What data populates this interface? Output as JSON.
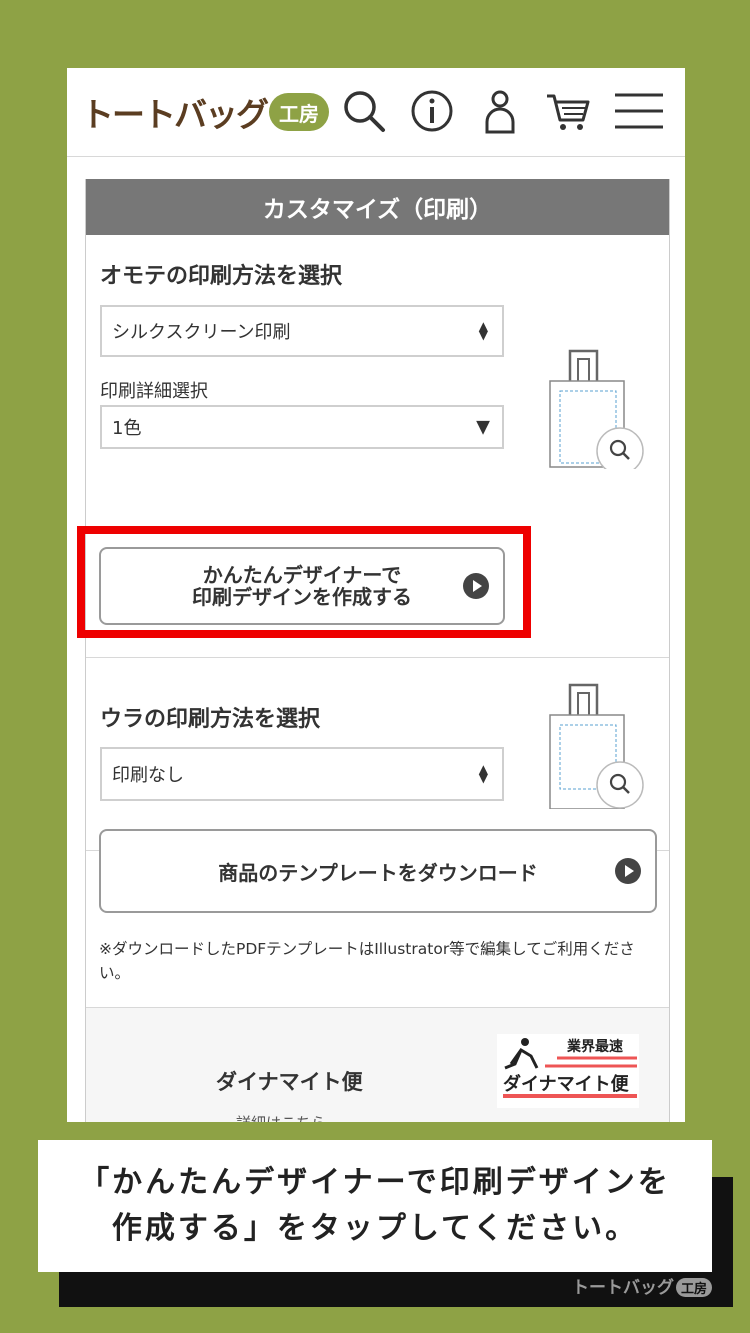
{
  "header": {
    "logo_text": "トートバッグ",
    "logo_badge": "工房"
  },
  "panel": {
    "title": "カスタマイズ（印刷）",
    "front": {
      "title": "オモテの印刷方法を選択",
      "method_value": "シルクスクリーン印刷",
      "detail_label": "印刷詳細選択",
      "detail_value": "1色",
      "designer_button_line1": "かんたんデザイナーで",
      "designer_button_line2": "印刷デザインを作成する"
    },
    "back": {
      "title": "ウラの印刷方法を選択",
      "method_value": "印刷なし"
    },
    "template_button": "商品のテンプレートをダウンロード",
    "template_note": "※ダウンロードしたPDFテンプレートはIllustrator等で編集してご利用ください。",
    "dynamite": {
      "title": "ダイナマイト便",
      "link": "詳細はこちら",
      "banner_line1": "業界最速",
      "banner_line2": "ダイナマイト便"
    }
  },
  "caption": {
    "line1": "「かんたんデザイナーで印刷デザインを",
    "line2": "作成する」をタップしてください。"
  },
  "watermark": {
    "text": "トートバッグ",
    "badge": "工房"
  },
  "colors": {
    "background": "#8ea245",
    "highlight": "#ee0000",
    "panel_header": "#777777",
    "logo_brown": "#5b3d21"
  }
}
